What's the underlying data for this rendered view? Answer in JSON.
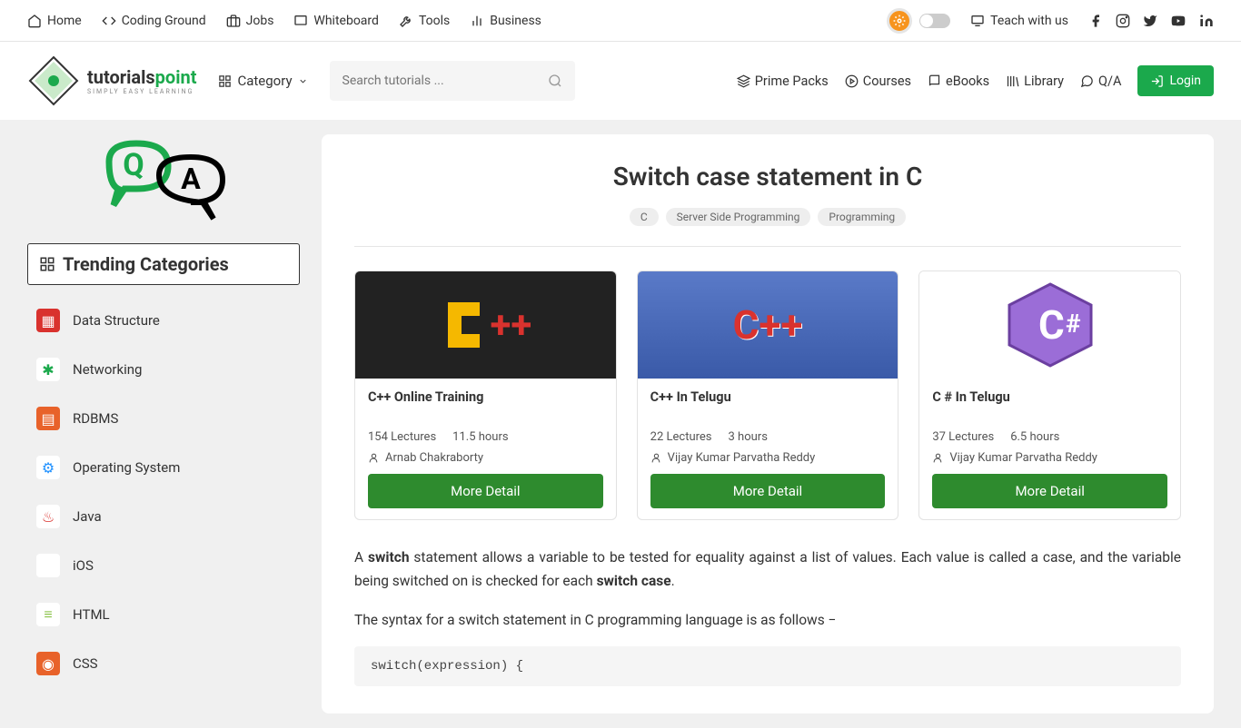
{
  "topbar": {
    "left": [
      {
        "label": "Home",
        "icon": "home"
      },
      {
        "label": "Coding Ground",
        "icon": "code"
      },
      {
        "label": "Jobs",
        "icon": "briefcase"
      },
      {
        "label": "Whiteboard",
        "icon": "rect"
      },
      {
        "label": "Tools",
        "icon": "tools"
      },
      {
        "label": "Business",
        "icon": "chart"
      }
    ],
    "teach": "Teach with us"
  },
  "navbar": {
    "logo_main1": "tutorials",
    "logo_main2": "point",
    "logo_sub": "SIMPLY EASY LEARNING",
    "category": "Category",
    "search_placeholder": "Search tutorials ...",
    "links": [
      {
        "label": "Prime Packs"
      },
      {
        "label": "Courses"
      },
      {
        "label": "eBooks"
      },
      {
        "label": "Library"
      },
      {
        "label": "Q/A"
      }
    ],
    "login": "Login"
  },
  "sidebar": {
    "trending": "Trending Categories",
    "cats": [
      {
        "label": "Data Structure",
        "bg": "#d9322e",
        "fg": "#fff",
        "char": "▦"
      },
      {
        "label": "Networking",
        "bg": "#fff",
        "fg": "#1ba94c",
        "char": "✱"
      },
      {
        "label": "RDBMS",
        "bg": "#e8622a",
        "fg": "#fff",
        "char": "▤"
      },
      {
        "label": "Operating System",
        "bg": "#fff",
        "fg": "#1e90ff",
        "char": "⚙"
      },
      {
        "label": "Java",
        "bg": "#fff",
        "fg": "#d9322e",
        "char": "♨"
      },
      {
        "label": "iOS",
        "bg": "#fff",
        "fg": "#000",
        "char": ""
      },
      {
        "label": "HTML",
        "bg": "#fff",
        "fg": "#8bc34a",
        "char": "≡"
      },
      {
        "label": "CSS",
        "bg": "#e8622a",
        "fg": "#fff",
        "char": "◉"
      }
    ]
  },
  "article": {
    "title": "Switch case statement in C",
    "tags": [
      "C",
      "Server Side Programming",
      "Programming"
    ],
    "courses": [
      {
        "title": "C++ Online Training",
        "lectures": "154 Lectures",
        "hours": "11.5 hours",
        "author": "Arnab Chakraborty",
        "btn": "More Detail",
        "thumb": "cpp1"
      },
      {
        "title": "C++ In Telugu",
        "lectures": "22 Lectures",
        "hours": "3 hours",
        "author": "Vijay Kumar Parvatha Reddy",
        "btn": "More Detail",
        "thumb": "cpp2"
      },
      {
        "title": "C # In Telugu",
        "lectures": "37 Lectures",
        "hours": "6.5 hours",
        "author": "Vijay Kumar Parvatha Reddy",
        "btn": "More Detail",
        "thumb": "csharp"
      }
    ],
    "p1_pre": "A ",
    "p1_b1": "switch",
    "p1_mid": " statement allows a variable to be tested for equality against a list of values. Each value is called a case, and the variable being switched on is checked for each ",
    "p1_b2": "switch case",
    "p1_post": ".",
    "p2": "The syntax for a switch statement in C programming language is as follows −",
    "code": "switch(expression) {"
  }
}
